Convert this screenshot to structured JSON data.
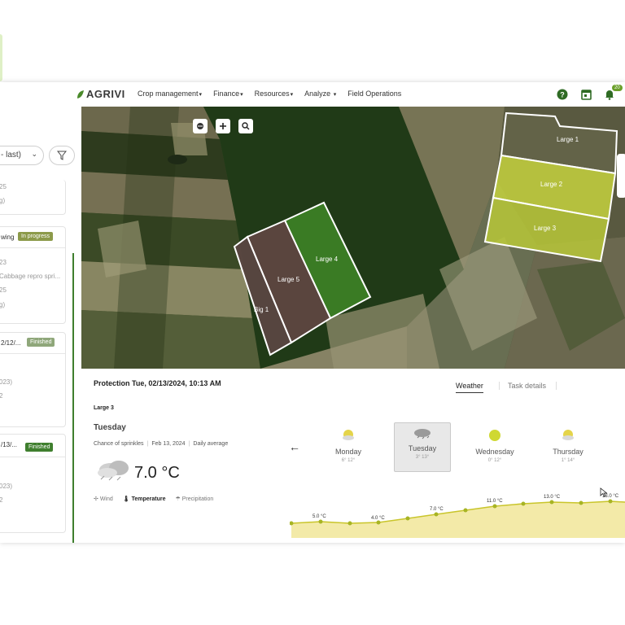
{
  "nav": {
    "logo": "AGRIVI",
    "menu": [
      "Crop management",
      "Finance",
      "Resources",
      "Analyze",
      "Field Operations"
    ],
    "notification_count": "20"
  },
  "sidebar": {
    "season_select": "- last)",
    "cards": [
      {
        "line1": "25",
        "line2": "g)"
      },
      {
        "status_label": "wing",
        "status": "In progress",
        "line1": "23",
        "line2": "Cabbage repro spri...",
        "line3": "25",
        "line4": "g)"
      },
      {
        "status_label": "2/12/...",
        "status": "Finished",
        "line1": "023)",
        "line2": "2"
      },
      {
        "status_label": "/13/...",
        "status": "Finished",
        "line1": "023)",
        "line2": "2"
      }
    ]
  },
  "map": {
    "fields": [
      "Large 1",
      "Large 2",
      "Large 3",
      "Large 4",
      "Large 5",
      "Big 1"
    ]
  },
  "panel": {
    "title": "Protection Tue, 02/13/2024, 10:13 AM",
    "tabs": [
      "Weather",
      "Task details"
    ],
    "field_name": "Large 3",
    "day": "Tuesday",
    "forecast_text": "Chance of sprinkles",
    "date": "Feb 13, 2024",
    "average_label": "Daily average",
    "temperature": "7.0 °C",
    "chips": [
      "Wind",
      "Temperature",
      "Precipitation"
    ],
    "days": [
      {
        "name": "Monday",
        "range": "6° 12°",
        "icon": "sun-cloud-icon"
      },
      {
        "name": "Tuesday",
        "range": "3° 13°",
        "icon": "cloud-rain-icon",
        "selected": true
      },
      {
        "name": "Wednesday",
        "range": "0° 12°",
        "icon": "sun-icon"
      },
      {
        "name": "Thursday",
        "range": "1° 14°",
        "icon": "sun-cloud-icon"
      }
    ],
    "chart_labels": [
      "5.0 °C",
      "4.0 °C",
      "7.0 °C",
      "11.0 °C",
      "13.0 °C",
      "13.0 °C"
    ]
  },
  "colors": {
    "accent": "#3f7f2e",
    "in_progress": "#8c9a4a",
    "finished": "#5f8f3a",
    "chart_fill": "#f3eaa8",
    "chart_line": "#c9c52b"
  }
}
